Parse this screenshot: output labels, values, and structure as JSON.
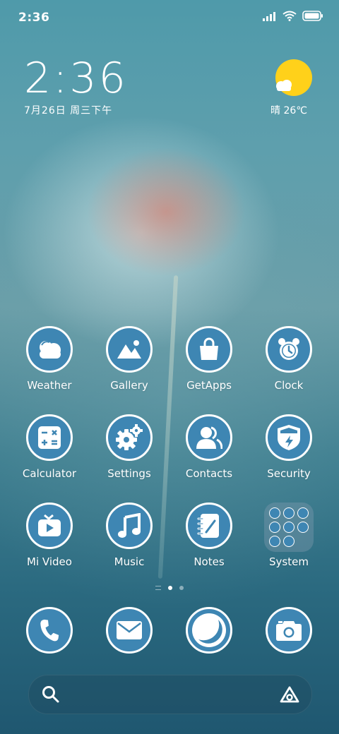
{
  "status_bar": {
    "time": "2:36"
  },
  "clock_widget": {
    "time": "2:36",
    "date": "7月26日 周三下午"
  },
  "weather_widget": {
    "condition_temp": "晴 26℃",
    "icon": "sun-cloud-icon"
  },
  "apps": [
    {
      "label": "Weather",
      "icon": "weather-icon"
    },
    {
      "label": "Gallery",
      "icon": "gallery-icon"
    },
    {
      "label": "GetApps",
      "icon": "shopping-bag-icon"
    },
    {
      "label": "Clock",
      "icon": "alarm-clock-icon"
    },
    {
      "label": "Calculator",
      "icon": "calculator-icon"
    },
    {
      "label": "Settings",
      "icon": "gear-icon"
    },
    {
      "label": "Contacts",
      "icon": "contacts-icon"
    },
    {
      "label": "Security",
      "icon": "shield-icon"
    },
    {
      "label": "Mi Video",
      "icon": "tv-play-icon"
    },
    {
      "label": "Music",
      "icon": "music-note-icon"
    },
    {
      "label": "Notes",
      "icon": "notebook-icon"
    },
    {
      "label": "System",
      "icon": "folder-icon"
    }
  ],
  "page_indicator": {
    "pages": 2,
    "current": 1
  },
  "dock": [
    {
      "icon": "phone-icon"
    },
    {
      "icon": "messages-icon"
    },
    {
      "icon": "browser-icon"
    },
    {
      "icon": "camera-icon"
    }
  ],
  "search_bar": {
    "left_icon": "search-icon",
    "right_icon": "app-vault-icon"
  },
  "colors": {
    "icon_fill": "#3e86b3",
    "icon_border": "#ffffff",
    "sun": "#ffd11a"
  }
}
